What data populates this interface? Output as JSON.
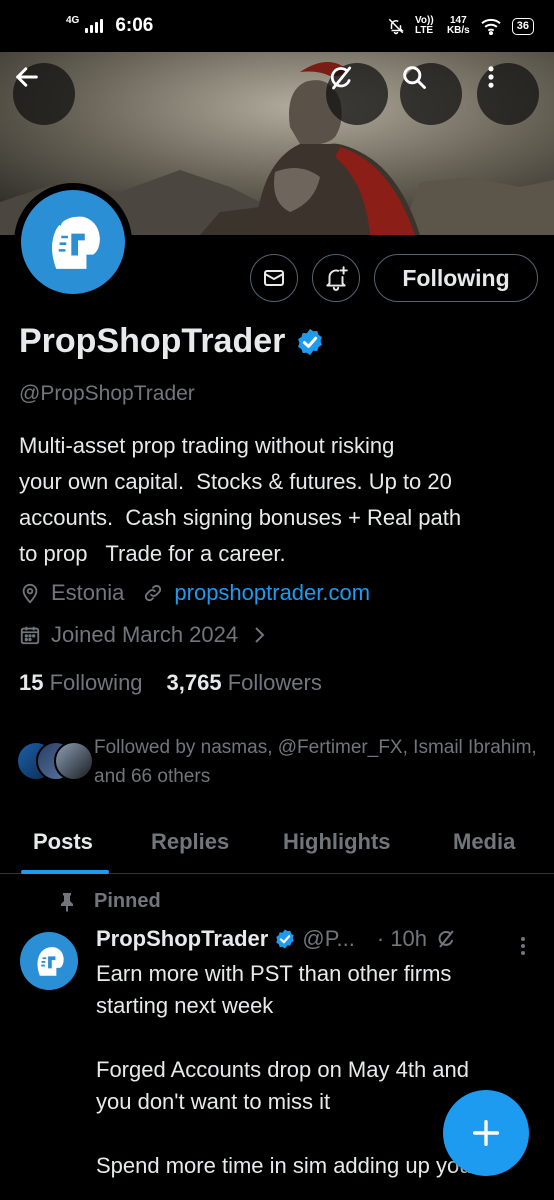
{
  "status_bar": {
    "network": "4G",
    "time": "6:06",
    "volte": "Vo)) LTE",
    "speed_value": "147",
    "speed_unit": "KB/s",
    "battery": "36"
  },
  "profile": {
    "name": "PropShopTrader",
    "verified": true,
    "handle": "@PropShopTrader",
    "bio": "Multi-asset prop trading without risking\nyour own capital.  Stocks & futures. Up to 20\naccounts.  Cash signing bonuses + Real path\nto prop   Trade for a career.",
    "location": "Estonia",
    "website": "propshoptrader.com",
    "joined": "Joined March 2024",
    "following_count": "15",
    "following_label": "Following",
    "followers_count": "3,765",
    "followers_label": "Followers",
    "followed_by": "Followed by nasmas, @Fertimer_FX, Ismail Ibrahim, and 66 others"
  },
  "actions": {
    "following_button": "Following",
    "message_icon": "envelope-icon",
    "notify_icon": "bell-plus-icon"
  },
  "banner_actions": {
    "back_icon": "arrow-left-icon",
    "grok_icon": "grok-icon",
    "search_icon": "search-icon",
    "more_icon": "more-vertical-icon"
  },
  "tabs": [
    {
      "label": "Posts",
      "active": true
    },
    {
      "label": "Replies",
      "active": false
    },
    {
      "label": "Highlights",
      "active": false
    },
    {
      "label": "Media",
      "active": false
    }
  ],
  "pinned_post": {
    "pinned_label": "Pinned",
    "author": "PropShopTrader",
    "handle_truncated": "@P...",
    "time": "· 10h",
    "text": "Earn more with PST than other firms\nstarting next week\n\nForged Accounts drop on May 4th and\nyou don't want to miss it\n\nSpend more time in sim adding up your"
  },
  "colors": {
    "accent": "#1d9bf0",
    "background": "#000000",
    "text_primary": "#e7e9ea",
    "text_secondary": "#71767b",
    "border": "#2f3336",
    "avatar_bg": "#2b8fd6"
  },
  "fab_icon": "plus-icon"
}
